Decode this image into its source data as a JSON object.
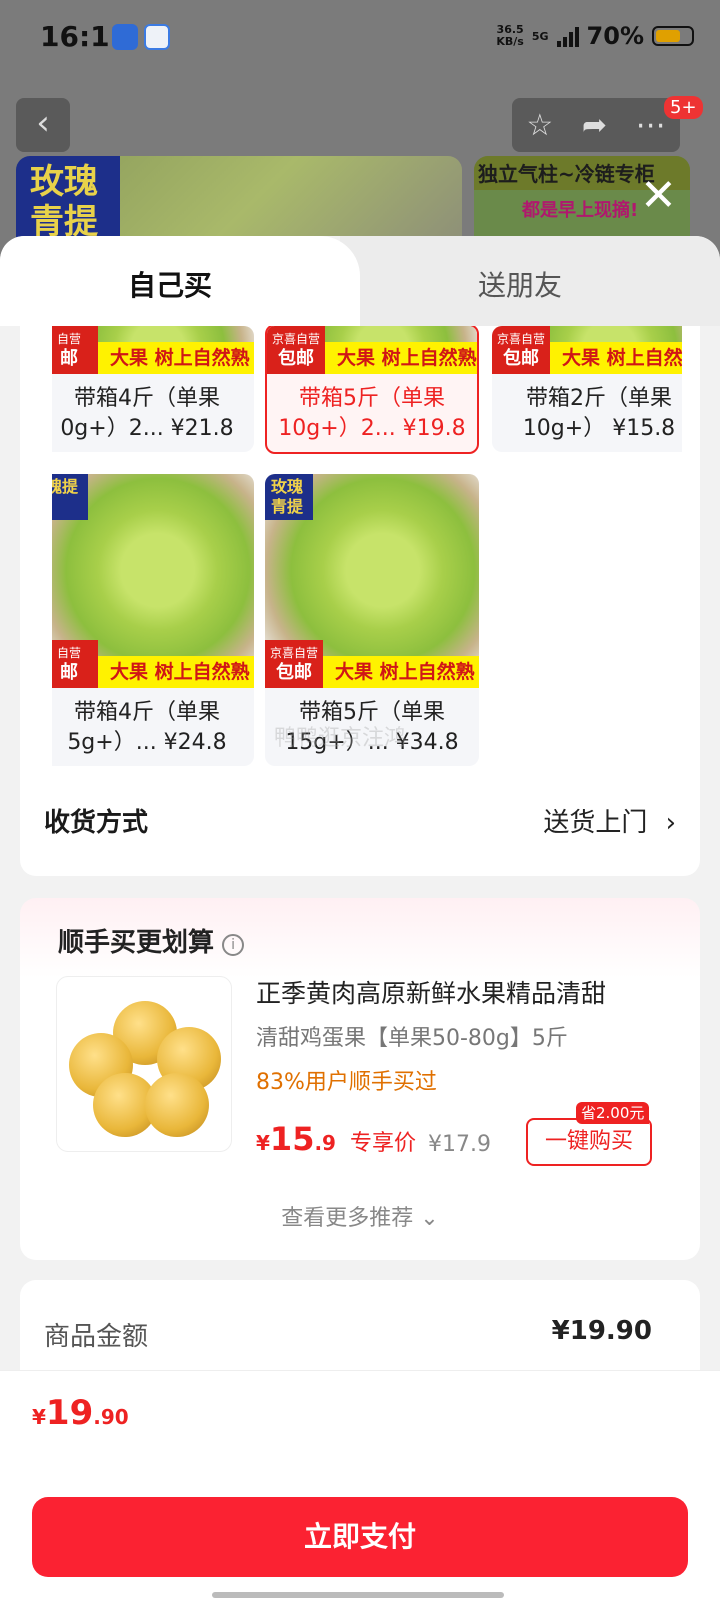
{
  "status_bar": {
    "time": "16:11",
    "speed_value": "36.5",
    "speed_unit": "KB/s",
    "network": "5G",
    "battery": "70%"
  },
  "background_page": {
    "image1_tag": "玫瑰青提",
    "image2_banner": "独立气柱~冷链专柜",
    "image2_sub": "都是早上现摘!",
    "notification_count": "5+"
  },
  "tabs": [
    {
      "label": "自己买"
    },
    {
      "label": "送朋友"
    }
  ],
  "options": [
    {
      "line1": "带箱4斤（单果",
      "line2": "0g+）2... ¥21.8",
      "tag_small": "自营",
      "tag_big": "邮",
      "banner": "大果  树上自然熟",
      "selected": false
    },
    {
      "line1": "带箱5斤（单果",
      "line2": "10g+）2... ¥19.8",
      "tag_small": "京喜自营",
      "tag_big": "包邮",
      "banner": "大果  树上自然熟",
      "selected": true
    },
    {
      "line1": "带箱2斤（单果",
      "line2": "10g+）  ¥15.8",
      "tag_small": "京喜自营",
      "tag_big": "包邮",
      "banner": "大果  树上自然熟",
      "selected": false
    },
    {
      "line1": "带箱4斤（单果",
      "line2": "5g+）...  ¥24.8",
      "tag_small": "自营",
      "tag_big": "邮",
      "banner": "大果  树上自然熟",
      "seal": "瑰提",
      "selected": false
    },
    {
      "line1": "带箱5斤（单果",
      "line2": "15g+）...  ¥34.8",
      "tag_small": "京喜自营",
      "tag_big": "包邮",
      "banner": "大果  树上自然熟",
      "seal": "玫瑰青提",
      "selected": false
    }
  ],
  "watermark": "鸭鸭逛京注鸿",
  "shipping": {
    "label": "收货方式",
    "value": "送货上门",
    "chevron": "›"
  },
  "recommend": {
    "title": "顺手买更划算",
    "info_icon": "i",
    "product_title": "正季黄肉高原新鲜水果精品清甜",
    "product_sub": "清甜鸡蛋果【单果50-80g】5斤",
    "bought": "83%用户顺手买过",
    "price_symbol": "¥",
    "price_int": "15",
    "price_dec": ".9",
    "price_tag": "专享价",
    "original_price": "¥17.9",
    "save_badge": "省2.00元",
    "buy_button": "一键购买",
    "more": "查看更多推荐 ⌄"
  },
  "summary": {
    "label": "商品金额",
    "value": "¥19.90"
  },
  "footer": {
    "price_symbol": "¥",
    "price_int": "19",
    "price_dec": ".90",
    "pay_button": "立即支付"
  },
  "colors": {
    "accent": "#e22222",
    "pay_button": "#fb2232",
    "warning": "#e07000"
  }
}
